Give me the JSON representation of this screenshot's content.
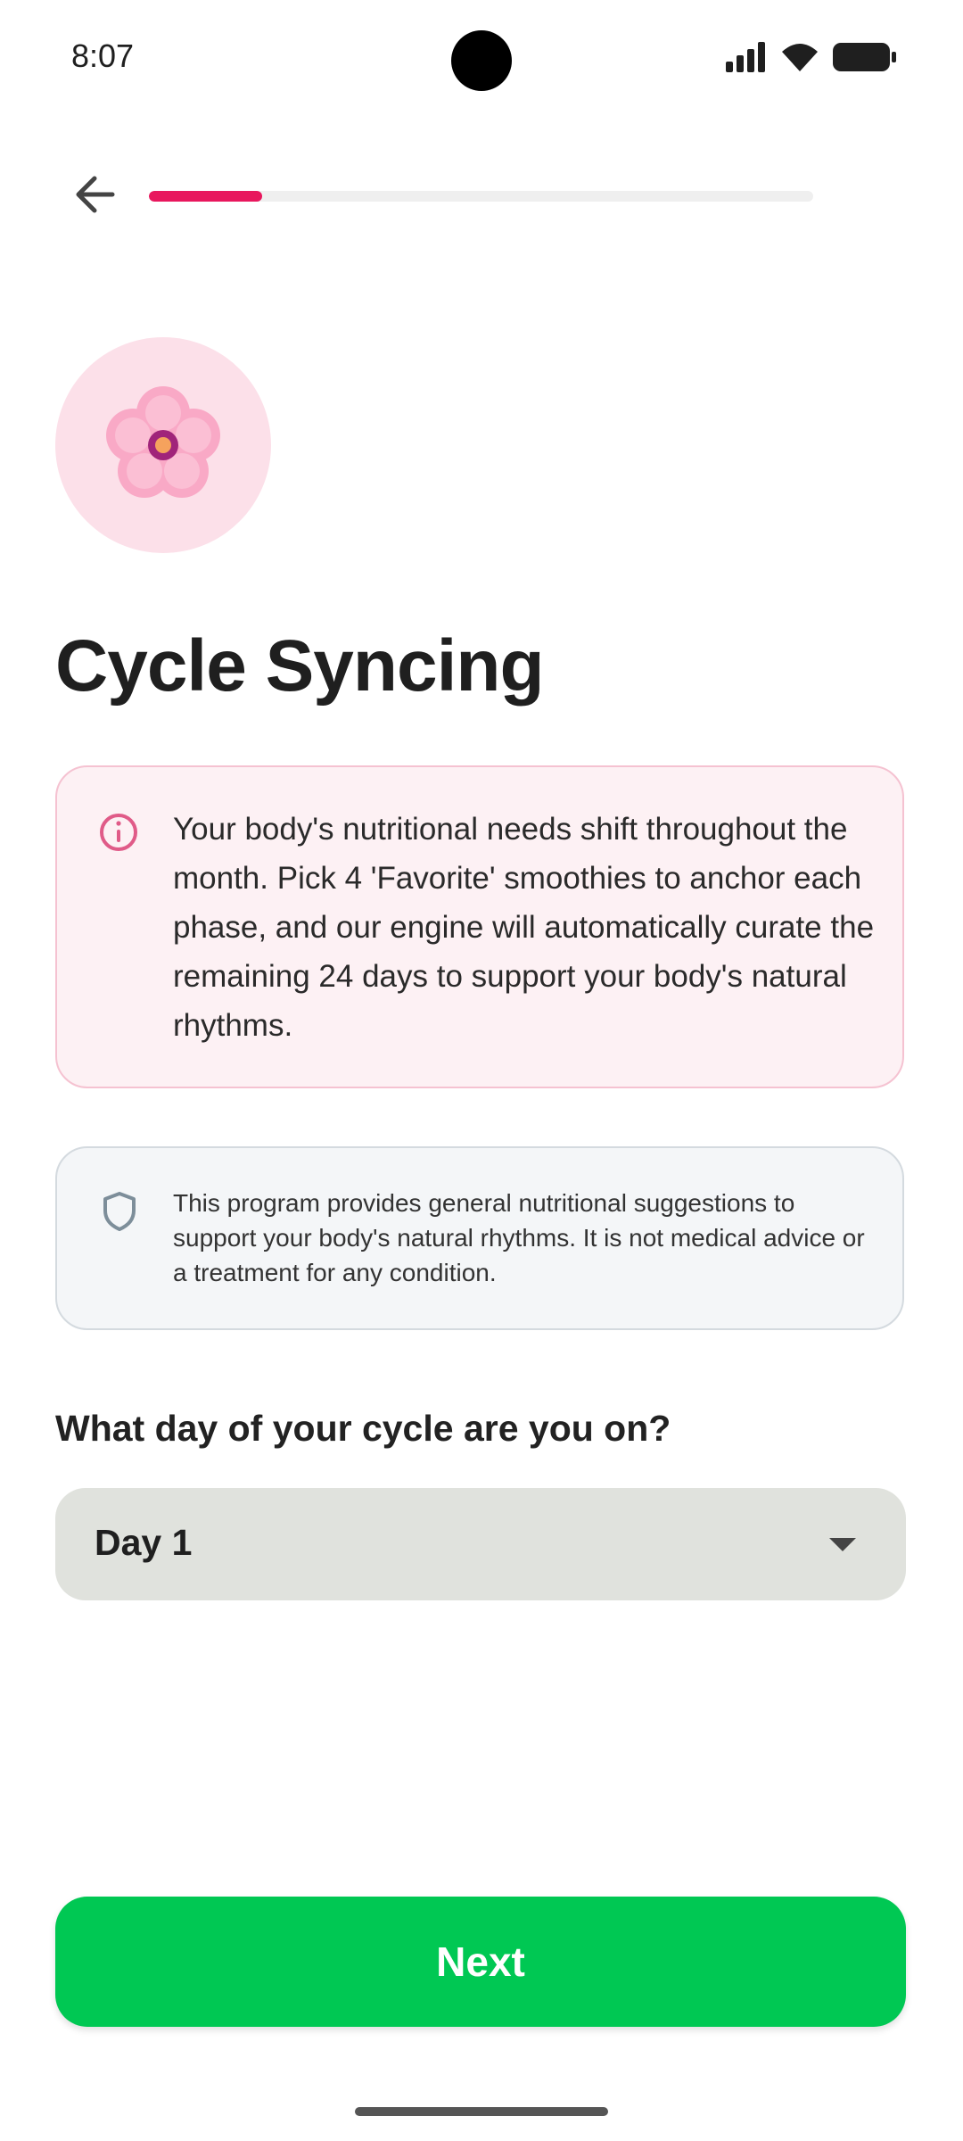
{
  "status_bar": {
    "time": "8:07"
  },
  "progress": {
    "fraction": 0.17,
    "color": "#e8175d"
  },
  "hero": {
    "icon": "cherry-blossom-icon",
    "background": "#fce0e9"
  },
  "title": "Cycle Syncing",
  "info_card": {
    "icon": "info-icon",
    "text": "Your body's nutritional needs shift throughout the month. Pick 4 'Favorite' smoothies to anchor each phase, and our engine will automatically curate the remaining 24 days to support your body's natural rhythms."
  },
  "disclaimer": {
    "icon": "shield-icon",
    "text": "This program provides general nutritional suggestions to support your body's natural rhythms. It is not medical advice or a treatment for any condition."
  },
  "question": "What day of your cycle are you on?",
  "day_select": {
    "value": "Day 1",
    "icon": "chevron-down-icon"
  },
  "next_button": {
    "label": "Next",
    "color": "#00c853"
  },
  "colors": {
    "accent": "#e8175d",
    "info_bg": "#fdf1f4",
    "info_border": "#f5c2d1"
  }
}
